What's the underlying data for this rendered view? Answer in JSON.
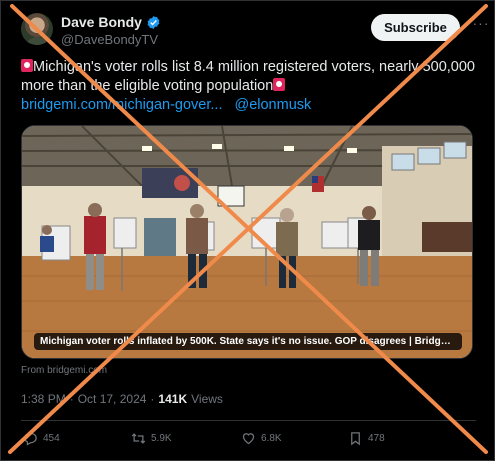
{
  "author": {
    "display_name": "Dave Bondy",
    "handle": "@DaveBondyTV"
  },
  "subscribe_label": "Subscribe",
  "more_label": "···",
  "tweet": {
    "text": "Michigan's voter rolls list 8.4 million registered voters, nearly 500,000 more than the eligible voting population",
    "link_text": "bridgemi.com/michigan-gover...",
    "mention": "@elonmusk"
  },
  "media": {
    "caption": "Michigan voter rolls inflated by 500K. State says it's no issue. GOP disagrees | Bridge ...",
    "source": "From bridgemi.com"
  },
  "meta": {
    "time": "1:38 PM",
    "dot": "·",
    "date": "Oct 17, 2024",
    "dot2": "·",
    "views_count": "141K",
    "views_label": "Views"
  },
  "actions": {
    "replies": "454",
    "reposts": "5.9K",
    "likes": "6.8K",
    "bookmarks": "478"
  },
  "colors": {
    "accent": "#1d9bf0",
    "cross": "#f08a4b",
    "background": "#000000"
  },
  "icons": [
    "verified-badge-icon",
    "siren-emoji-icon",
    "reply-icon",
    "repost-icon",
    "like-icon",
    "bookmark-icon"
  ]
}
